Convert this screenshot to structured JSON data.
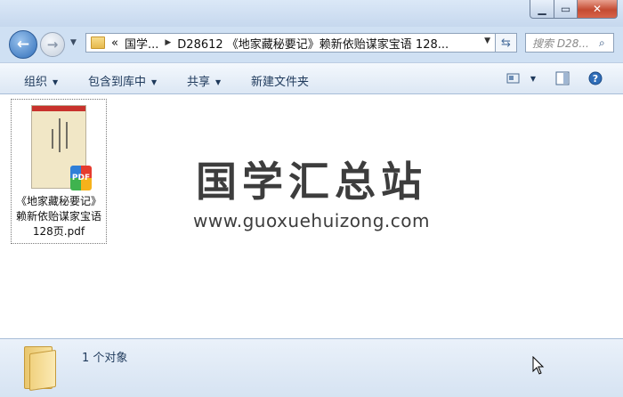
{
  "window": {
    "minimize_icon": "minimize-icon",
    "maximize_icon": "maximize-icon",
    "close_icon": "close-icon"
  },
  "nav": {
    "back_icon": "back-arrow-icon",
    "forward_icon": "forward-arrow-icon",
    "breadcrumb_overflow": "«",
    "breadcrumb": [
      "国学...",
      "D28612 《地家藏秘要记》赖新依贻谋家宝语 128..."
    ],
    "search_placeholder": "搜索 D28..."
  },
  "toolbar": {
    "organize": "组织",
    "include_in_library": "包含到库中",
    "share": "共享",
    "new_folder": "新建文件夹"
  },
  "files": [
    {
      "name": "《地家藏秘要记》赖新依贻谋家宝语128页.pdf",
      "name_lines": [
        "《地家藏秘要记》",
        "赖新依贻谋家宝语",
        "128页.pdf"
      ],
      "badge": "PDF"
    }
  ],
  "watermark": {
    "title": "国学汇总站",
    "url": "www.guoxuehuizong.com"
  },
  "status": {
    "count_text": "1 个对象"
  },
  "colors": {
    "accent": "#1e395b",
    "close": "#c44b32"
  }
}
